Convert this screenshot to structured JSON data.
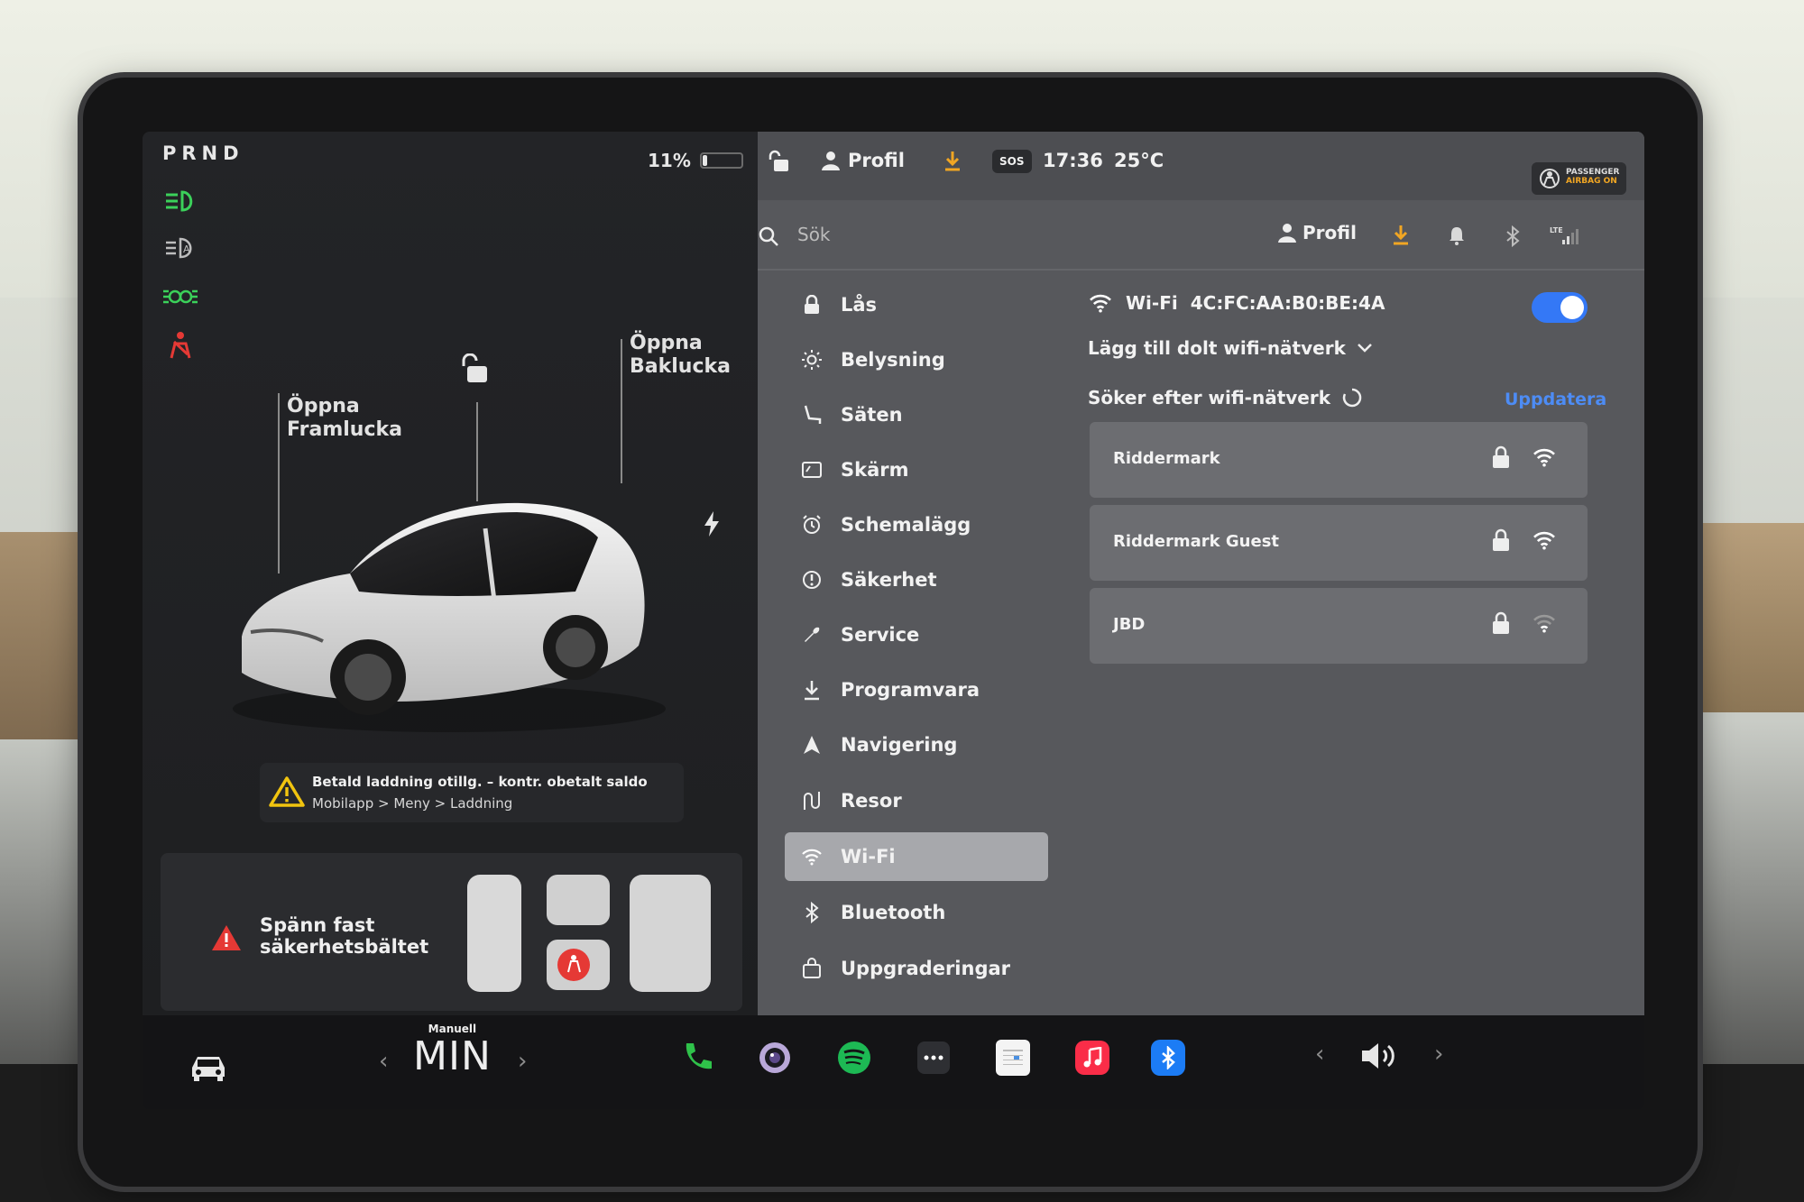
{
  "status": {
    "gear": "PRND",
    "battery_percent": "11%",
    "battery_level": 0.11,
    "time": "17:36",
    "temperature": "25°C",
    "airbag_label": "PASSENGER",
    "airbag_state": "AIRBAG ON",
    "sos": "SOS"
  },
  "car_panel": {
    "frunk_label": "Öppna\nFramlucka",
    "trunk_label": "Öppna\nBaklucka",
    "charge_warning_line1": "Betald laddning otillg. – kontr. obetalt saldo",
    "charge_warning_line2": "Mobilapp > Meny > Laddning",
    "seatbelt_warning": "Spänn fast\nsäkerhetsbältet"
  },
  "topbar": {
    "profile_label": "Profil"
  },
  "settings": {
    "search_placeholder": "Sök",
    "profile_label": "Profil",
    "menu": [
      {
        "label": "Lås",
        "icon": "lock-icon"
      },
      {
        "label": "Belysning",
        "icon": "sun-icon"
      },
      {
        "label": "Säten",
        "icon": "seat-icon"
      },
      {
        "label": "Skärm",
        "icon": "display-icon"
      },
      {
        "label": "Schemalägg",
        "icon": "alarm-clock-icon"
      },
      {
        "label": "Säkerhet",
        "icon": "info-circle-icon"
      },
      {
        "label": "Service",
        "icon": "wrench-icon"
      },
      {
        "label": "Programvara",
        "icon": "download-icon"
      },
      {
        "label": "Navigering",
        "icon": "navigation-arrow-icon"
      },
      {
        "label": "Resor",
        "icon": "trips-icon"
      },
      {
        "label": "Wi-Fi",
        "icon": "wifi-icon"
      },
      {
        "label": "Bluetooth",
        "icon": "bluetooth-icon"
      },
      {
        "label": "Uppgraderingar",
        "icon": "shopping-bag-icon"
      }
    ],
    "active_menu": "Wi-Fi",
    "wifi": {
      "title": "Wi-Fi",
      "mac": "4C:FC:AA:B0:BE:4A",
      "enabled": true,
      "add_hidden": "Lägg till dolt wifi-nätverk",
      "searching": "Söker efter wifi-nätverk",
      "refresh": "Uppdatera",
      "networks": [
        {
          "name": "Riddermark",
          "locked": true,
          "signal": "strong"
        },
        {
          "name": "Riddermark Guest",
          "locked": true,
          "signal": "strong"
        },
        {
          "name": "JBD",
          "locked": true,
          "signal": "weak"
        }
      ]
    }
  },
  "dock": {
    "climate_mode": "Manuell",
    "climate_value": "MIN",
    "accent_colors": {
      "phone": "#2fc24a",
      "spotify": "#1db954",
      "music": "#fa2d48",
      "bluetooth": "#1c7cf5",
      "toggle": "#3478f6",
      "link": "#4d8cf5",
      "warning": "#f1c40f",
      "alert": "#e53935"
    }
  }
}
